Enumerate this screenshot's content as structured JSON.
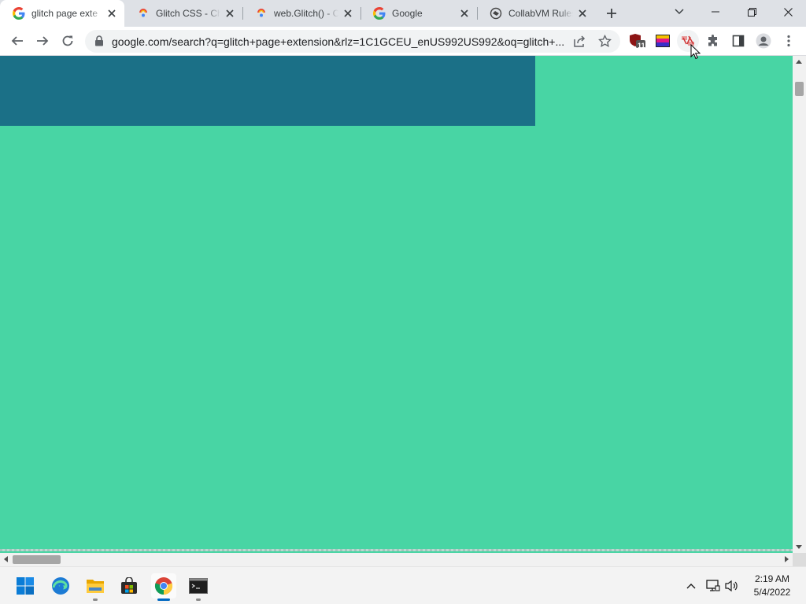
{
  "browser": {
    "tabs": [
      {
        "title": "glitch page exte",
        "favicon": "google-g-icon",
        "active": true
      },
      {
        "title": "Glitch CSS - Chr",
        "favicon": "chrome-webstore-icon",
        "active": false
      },
      {
        "title": "web.Glitch() - C",
        "favicon": "chrome-webstore-icon",
        "active": false
      },
      {
        "title": "Google",
        "favicon": "google-g-icon",
        "active": false
      },
      {
        "title": "CollabVM Rules",
        "favicon": "collabvm-icon",
        "active": false
      }
    ],
    "url": "google.com/search?q=glitch+page+extension&rlz=1C1GCEU_enUS992US992&oq=glitch+...",
    "extension_badge": "11"
  },
  "page": {
    "background_color": "#48d5a4",
    "glitch_block_color": "#1b7087"
  },
  "taskbar": {
    "apps": [
      "start-icon",
      "edge-icon",
      "file-explorer-icon",
      "store-icon",
      "chrome-icon",
      "terminal-icon"
    ],
    "time": "2:19 AM",
    "date": "5/4/2022"
  }
}
